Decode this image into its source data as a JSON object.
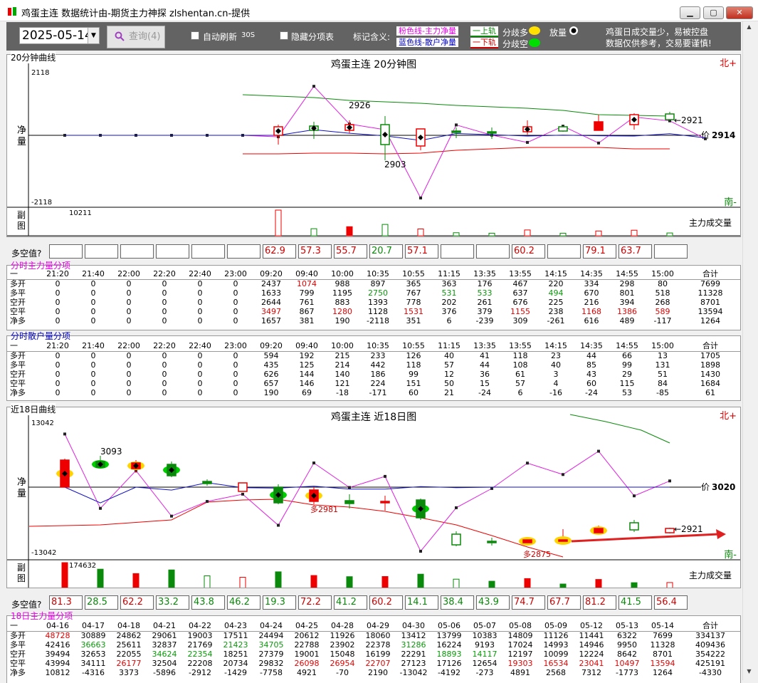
{
  "window": {
    "title": "鸡蛋主连  数据统计由-期货主力神探 zlshentan.cn-提供",
    "min": "▁",
    "max": "▢",
    "close": "✕"
  },
  "toolbar": {
    "date": "2025-05-14",
    "query_label": "查询(4)",
    "auto_refresh_label": "自动刷新",
    "auto_refresh_interval": "30S",
    "hide_items_label": "隐藏分项表",
    "legend_title": "标记含义:",
    "legend_pink": "粉色线-主力净量",
    "legend_blue": "蓝色线-散户净量",
    "legend_up": "上轨",
    "legend_down": "下轨",
    "diverge_more": "分歧多",
    "diverge_less": "分歧空",
    "volume_label": "放量",
    "notice_line1": "鸡蛋日成交量少，易被控盘",
    "notice_line2": "数据仅供参考，交易要谨慎!"
  },
  "chart20": {
    "panel_label": "20分钟曲线",
    "title": "鸡蛋主连 20分钟图",
    "ymax": "2118",
    "ymin": "-2118",
    "axis_label": "净量",
    "north": "北+",
    "south": "南-",
    "price_label": "价",
    "price": "2914",
    "high_label": "2926",
    "low_label": "2903",
    "last_label": "←2921",
    "sub_label": "副图",
    "vol_label": "主力成交量",
    "vol_max": "10211",
    "times": [
      "21:20",
      "21:40",
      "22:00",
      "22:20",
      "22:40",
      "23:00",
      "09:20",
      "09:40",
      "10:00",
      "10:35",
      "10:55",
      "11:15",
      "13:35",
      "13:55",
      "14:15",
      "14:35",
      "14:55",
      "15:00"
    ],
    "dk_label": "多空值?",
    "dk": [
      "",
      "",
      "",
      "",
      "",
      "",
      "62.9",
      "57.3",
      "55.7",
      "20.7",
      "57.1",
      "",
      "",
      "60.2",
      "",
      "79.1",
      "63.7",
      ""
    ],
    "pink": [
      0,
      0,
      0,
      0,
      0,
      0,
      -50,
      1657,
      381,
      190,
      -2118,
      351,
      6,
      -239,
      309,
      -261,
      616,
      489,
      -117
    ],
    "blue": [
      0,
      0,
      0,
      0,
      0,
      0,
      0,
      190,
      69,
      -18,
      -171,
      60,
      21,
      -24,
      6,
      -16,
      -24,
      53,
      -85
    ],
    "vol": [
      0,
      0,
      0,
      0,
      0,
      0,
      10211,
      2800,
      3600,
      4500,
      2700,
      1200,
      1000,
      2300,
      1000,
      1900,
      2200,
      1100
    ]
  },
  "main20": {
    "label": "分时主力量分项",
    "header": [
      "一",
      "21:20",
      "21:40",
      "22:00",
      "22:20",
      "22:40",
      "23:00",
      "09:20",
      "09:40",
      "10:00",
      "10:35",
      "10:55",
      "11:15",
      "13:35",
      "13:55",
      "14:15",
      "14:35",
      "14:55",
      "15:00",
      "合计"
    ],
    "rows": [
      [
        "多开",
        "0",
        "0",
        "0",
        "0",
        "0",
        "0",
        "2437",
        "1074",
        "988",
        "897",
        "365",
        "363",
        "176",
        "467",
        "220",
        "334",
        "298",
        "80",
        "7699"
      ],
      [
        "多平",
        "0",
        "0",
        "0",
        "0",
        "0",
        "0",
        "1633",
        "799",
        "1195",
        "2750",
        "767",
        "531",
        "533",
        "637",
        "494",
        "670",
        "801",
        "518",
        "11328"
      ],
      [
        "空开",
        "0",
        "0",
        "0",
        "0",
        "0",
        "0",
        "2644",
        "761",
        "883",
        "1393",
        "778",
        "202",
        "261",
        "676",
        "225",
        "216",
        "394",
        "268",
        "8701"
      ],
      [
        "空平",
        "0",
        "0",
        "0",
        "0",
        "0",
        "0",
        "3497",
        "867",
        "1280",
        "1128",
        "1531",
        "376",
        "379",
        "1155",
        "238",
        "1168",
        "1386",
        "589",
        "13594"
      ],
      [
        "净多",
        "0",
        "0",
        "0",
        "0",
        "0",
        "0",
        "1657",
        "381",
        "190",
        "-2118",
        "351",
        "6",
        "-239",
        "309",
        "-261",
        "616",
        "489",
        "-117",
        "1264"
      ]
    ]
  },
  "retail20": {
    "label": "分时散户量分项",
    "header": [
      "一",
      "21:20",
      "21:40",
      "22:00",
      "22:20",
      "22:40",
      "23:00",
      "09:20",
      "09:40",
      "10:00",
      "10:35",
      "10:55",
      "11:15",
      "13:35",
      "13:55",
      "14:15",
      "14:35",
      "14:55",
      "15:00",
      "合计"
    ],
    "rows": [
      [
        "多开",
        "0",
        "0",
        "0",
        "0",
        "0",
        "0",
        "594",
        "192",
        "215",
        "233",
        "126",
        "40",
        "41",
        "118",
        "23",
        "44",
        "66",
        "13",
        "1705"
      ],
      [
        "多平",
        "0",
        "0",
        "0",
        "0",
        "0",
        "0",
        "435",
        "125",
        "214",
        "442",
        "118",
        "57",
        "44",
        "108",
        "40",
        "85",
        "99",
        "131",
        "1898"
      ],
      [
        "空开",
        "0",
        "0",
        "0",
        "0",
        "0",
        "0",
        "626",
        "144",
        "140",
        "186",
        "99",
        "12",
        "36",
        "61",
        "3",
        "43",
        "29",
        "51",
        "1430"
      ],
      [
        "空平",
        "0",
        "0",
        "0",
        "0",
        "0",
        "0",
        "657",
        "146",
        "121",
        "224",
        "151",
        "50",
        "15",
        "57",
        "4",
        "60",
        "115",
        "84",
        "1684"
      ],
      [
        "净多",
        "0",
        "0",
        "0",
        "0",
        "0",
        "0",
        "190",
        "69",
        "-18",
        "-171",
        "60",
        "21",
        "-24",
        "6",
        "-16",
        "-24",
        "53",
        "-85",
        "61"
      ]
    ]
  },
  "chart18": {
    "panel_label": "近18日曲线",
    "title": "鸡蛋主连 近18日图",
    "ymax": "13042",
    "ymin": "-13042",
    "axis_label": "净量",
    "north": "北+",
    "south": "南-",
    "price_label": "价",
    "price": "3020",
    "high_label": "3093",
    "mid_label": "多2981",
    "low_label": "多2875",
    "last_label": "←2921",
    "sub_label": "副图",
    "vol_label": "主力成交量",
    "vol_max": "174632",
    "dates": [
      "04-16",
      "04-17",
      "04-18",
      "04-21",
      "04-22",
      "04-23",
      "04-24",
      "04-25",
      "04-28",
      "04-29",
      "04-30",
      "05-06",
      "05-07",
      "05-08",
      "05-09",
      "05-12",
      "05-13",
      "05-14"
    ],
    "dk_label": "多空值?",
    "dk": [
      "81.3",
      "28.5",
      "62.2",
      "33.2",
      "43.8",
      "46.2",
      "19.3",
      "72.2",
      "41.2",
      "60.2",
      "14.1",
      "38.4",
      "43.9",
      "74.7",
      "67.7",
      "81.2",
      "41.5",
      "56.4"
    ],
    "pink": [
      10812,
      -4316,
      3373,
      -5896,
      -2912,
      -1429,
      -7758,
      4921,
      -70,
      2190,
      -13042,
      -4192,
      -273,
      4891,
      2568,
      7312,
      -1773,
      1264
    ],
    "blue": [
      0,
      -3200,
      0,
      -600,
      900,
      -100,
      -200,
      200,
      -400,
      -400,
      100,
      -100,
      0,
      0,
      0,
      0,
      0,
      0
    ],
    "vol": [
      174632,
      130000,
      100000,
      125000,
      85000,
      75000,
      112000,
      87000,
      79000,
      80000,
      96000,
      62000,
      48000,
      66000,
      29000,
      60000,
      38000,
      39000
    ]
  },
  "main18": {
    "label": "18日主力量分项",
    "header": [
      "一",
      "04-16",
      "04-17",
      "04-18",
      "04-21",
      "04-22",
      "04-23",
      "04-24",
      "04-25",
      "04-28",
      "04-29",
      "04-30",
      "05-06",
      "05-07",
      "05-08",
      "05-09",
      "05-12",
      "05-13",
      "05-14",
      "合计"
    ],
    "rows": [
      [
        "多开",
        "48728",
        "30889",
        "24862",
        "29061",
        "19003",
        "17511",
        "24494",
        "20612",
        "11926",
        "18060",
        "13412",
        "13799",
        "10383",
        "14809",
        "11126",
        "11441",
        "6322",
        "7699",
        "334137"
      ],
      [
        "多平",
        "42416",
        "36663",
        "25611",
        "32837",
        "21769",
        "21423",
        "34705",
        "22788",
        "23902",
        "22378",
        "31286",
        "16224",
        "9193",
        "17024",
        "14993",
        "14946",
        "9950",
        "11328",
        "409436"
      ],
      [
        "空开",
        "39494",
        "32653",
        "22055",
        "34624",
        "22354",
        "18251",
        "27379",
        "19001",
        "15048",
        "16199",
        "22291",
        "18893",
        "14117",
        "12197",
        "10099",
        "12224",
        "8642",
        "8701",
        "354222"
      ],
      [
        "空平",
        "43994",
        "34111",
        "26177",
        "32504",
        "22208",
        "20734",
        "29832",
        "26098",
        "26954",
        "22707",
        "27123",
        "17126",
        "12654",
        "19303",
        "16534",
        "23041",
        "10497",
        "13594",
        "425191"
      ],
      [
        "净多",
        "10812",
        "-4316",
        "3373",
        "-5896",
        "-2912",
        "-1429",
        "-7758",
        "4921",
        "-70",
        "2190",
        "-13042",
        "-4192",
        "-273",
        "4891",
        "2568",
        "7312",
        "-1773",
        "1264",
        "-4330"
      ]
    ]
  }
}
